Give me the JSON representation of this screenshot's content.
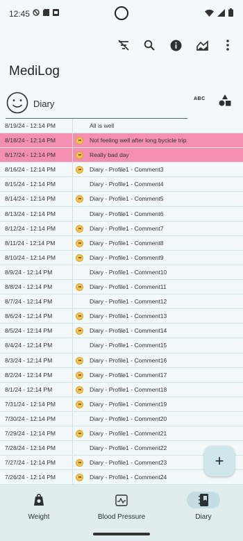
{
  "status": {
    "time": "12:45"
  },
  "app": {
    "title": "MediLog"
  },
  "toolbar": {
    "icons": [
      "filter-off-icon",
      "search-icon",
      "info-icon",
      "chart-icon",
      "more-vert-icon"
    ]
  },
  "tab": {
    "label": "Diary",
    "abc": "ABC"
  },
  "rows": [
    {
      "date": "8/19/24 - 12:14 PM",
      "comment": "All is well",
      "emoji": false,
      "highlight": false
    },
    {
      "date": "8/18/24 - 12:14 PM",
      "comment": "Not feeling well after long bycicle trip",
      "emoji": true,
      "highlight": true
    },
    {
      "date": "8/17/24 - 12:14 PM",
      "comment": "Really bad day",
      "emoji": true,
      "highlight": true
    },
    {
      "date": "8/16/24 - 12:14 PM",
      "comment": "Diary - Profile1 - Comment3",
      "emoji": true,
      "highlight": false
    },
    {
      "date": "8/15/24 - 12:14 PM",
      "comment": "Diary - Profile1 - Comment4",
      "emoji": false,
      "highlight": false
    },
    {
      "date": "8/14/24 - 12:14 PM",
      "comment": "Diary - Profile1 - Comment5",
      "emoji": true,
      "highlight": false
    },
    {
      "date": "8/13/24 - 12:14 PM",
      "comment": "Diary - Profile1 - Comment6",
      "emoji": false,
      "highlight": false
    },
    {
      "date": "8/12/24 - 12:14 PM",
      "comment": "Diary - Profile1 - Comment7",
      "emoji": true,
      "highlight": false
    },
    {
      "date": "8/11/24 - 12:14 PM",
      "comment": "Diary - Profile1 - Comment8",
      "emoji": true,
      "highlight": false
    },
    {
      "date": "8/10/24 - 12:14 PM",
      "comment": "Diary - Profile1 - Comment9",
      "emoji": true,
      "highlight": false
    },
    {
      "date": "8/9/24 - 12:14 PM",
      "comment": "Diary - Profile1 - Comment10",
      "emoji": false,
      "highlight": false
    },
    {
      "date": "8/8/24 - 12:14 PM",
      "comment": "Diary - Profile1 - Comment11",
      "emoji": true,
      "highlight": false
    },
    {
      "date": "8/7/24 - 12:14 PM",
      "comment": "Diary - Profile1 - Comment12",
      "emoji": false,
      "highlight": false
    },
    {
      "date": "8/6/24 - 12:14 PM",
      "comment": "Diary - Profile1 - Comment13",
      "emoji": true,
      "highlight": false
    },
    {
      "date": "8/5/24 - 12:14 PM",
      "comment": "Diary - Profile1 - Comment14",
      "emoji": true,
      "highlight": false
    },
    {
      "date": "8/4/24 - 12:14 PM",
      "comment": "Diary - Profile1 - Comment15",
      "emoji": false,
      "highlight": false
    },
    {
      "date": "8/3/24 - 12:14 PM",
      "comment": "Diary - Profile1 - Comment16",
      "emoji": true,
      "highlight": false
    },
    {
      "date": "8/2/24 - 12:14 PM",
      "comment": "Diary - Profile1 - Comment17",
      "emoji": true,
      "highlight": false
    },
    {
      "date": "8/1/24 - 12:14 PM",
      "comment": "Diary - Profile1 - Comment18",
      "emoji": true,
      "highlight": false
    },
    {
      "date": "7/31/24 - 12:14 PM",
      "comment": "Diary - Profile1 - Comment19",
      "emoji": true,
      "highlight": false
    },
    {
      "date": "7/30/24 - 12:14 PM",
      "comment": "Diary - Profile1 - Comment20",
      "emoji": false,
      "highlight": false
    },
    {
      "date": "7/29/24 - 12:14 PM",
      "comment": "Diary - Profile1 - Comment21",
      "emoji": true,
      "highlight": false
    },
    {
      "date": "7/28/24 - 12:14 PM",
      "comment": "Diary - Profile1 - Comment22",
      "emoji": false,
      "highlight": false
    },
    {
      "date": "7/27/24 - 12:14 PM",
      "comment": "Diary - Profile1 - Comment23",
      "emoji": true,
      "highlight": false
    },
    {
      "date": "7/26/24 - 12:14 PM",
      "comment": "Diary - Profile1 - Comment24",
      "emoji": true,
      "highlight": false
    }
  ],
  "fab": {
    "label": "+"
  },
  "nav": [
    {
      "label": "Weight",
      "icon": "weight-icon",
      "active": false
    },
    {
      "label": "Blood Pressure",
      "icon": "blood-pressure-icon",
      "active": false
    },
    {
      "label": "Diary",
      "icon": "diary-icon",
      "active": true
    }
  ],
  "colors": {
    "highlight": "#f48fb1",
    "nav_active": "#c3dde3",
    "fab": "#cfe6ea"
  }
}
